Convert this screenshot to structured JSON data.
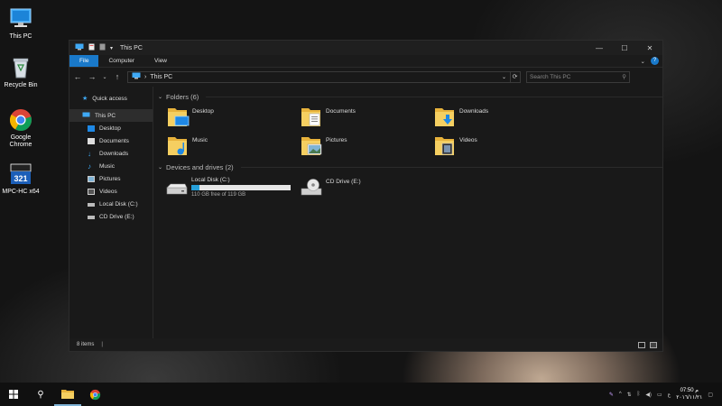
{
  "desktop": {
    "icons": [
      {
        "label": "This PC",
        "icon": "this-pc-icon"
      },
      {
        "label": "Recycle Bin",
        "icon": "recycle-bin-icon"
      },
      {
        "label": "Google\nChrome",
        "icon": "chrome-icon"
      },
      {
        "label": "MPC-HC x64",
        "icon": "mpc-hc-icon"
      }
    ]
  },
  "window": {
    "title": "This PC",
    "controls": {
      "minimize": "—",
      "maximize": "☐",
      "close": "✕"
    },
    "ribbon": {
      "tabs": [
        "File",
        "Computer",
        "View"
      ],
      "active": "File"
    },
    "address": {
      "path": "This PC",
      "separator": "›"
    },
    "search": {
      "placeholder": "Search This PC"
    },
    "nav": {
      "quick_access": "Quick access",
      "this_pc": "This PC",
      "items": [
        "Desktop",
        "Documents",
        "Downloads",
        "Music",
        "Pictures",
        "Videos",
        "Local Disk (C:)",
        "CD Drive (E:)"
      ]
    },
    "folders_group": "Folders (6)",
    "folders": [
      "Desktop",
      "Documents",
      "Downloads",
      "Music",
      "Pictures",
      "Videos"
    ],
    "drives_group": "Devices and drives (2)",
    "drives": [
      {
        "name": "Local Disk (C:)",
        "free": "110 GB free of 119 GB",
        "used_fraction": 0.08
      },
      {
        "name": "CD Drive (E:)"
      }
    ],
    "status": "8 items"
  },
  "taskbar": {
    "clock_time": "07:50 م",
    "clock_date": "٢٠١٦/١١/٢١",
    "lang": "ع"
  },
  "colors": {
    "accent": "#1979ca",
    "folder": "#f2c94c",
    "drive_bar": "#26a0da"
  }
}
